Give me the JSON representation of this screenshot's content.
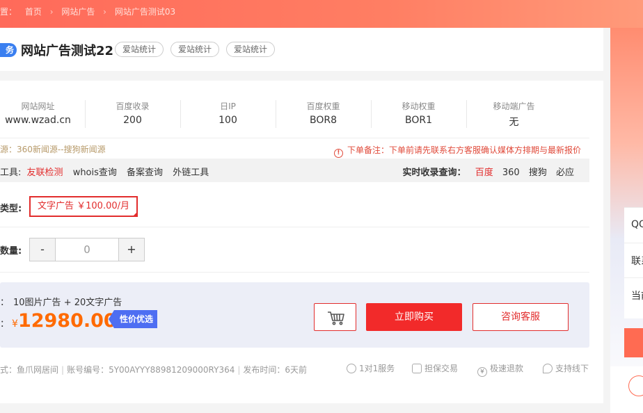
{
  "breadcrumb": {
    "prefix": "置：",
    "items": [
      "首页",
      "网站广告",
      "网站广告测试03"
    ],
    "separator": "›"
  },
  "listing": {
    "service_badge": "务",
    "title": "网站广告测试22",
    "tags": [
      "爱站统计",
      "爱站统计",
      "爱站统计"
    ]
  },
  "stats": [
    {
      "label": "网站网址",
      "value": "www.wzad.cn"
    },
    {
      "label": "百度收录",
      "value": "200"
    },
    {
      "label": "日IP",
      "value": "100"
    },
    {
      "label": "百度权重",
      "value": "BOR8"
    },
    {
      "label": "移动权重",
      "value": "BOR1"
    },
    {
      "label": "移动端广告",
      "value": "无"
    }
  ],
  "source_text": "源：360新闻源--搜狗新闻源",
  "order_note": "下单备注：下单前请先联系右方客服确认媒体方排期与最新报价",
  "tools": {
    "label": "工具:",
    "items": [
      "友联检测",
      "whois查询",
      "备案查询",
      "外链工具"
    ],
    "realtime_label": "实时收录查询：",
    "engines": [
      "百度",
      "360",
      "搜狗",
      "必应"
    ]
  },
  "ad_type": {
    "label": "类型:",
    "option": "文字广告 ￥100.00/月"
  },
  "quantity": {
    "label": "数量:",
    "minus": "-",
    "value": "0",
    "plus": "+"
  },
  "package": {
    "label": "：",
    "text": "10图片广告 + 20文字广告",
    "price_label": "：",
    "currency": "¥",
    "price": "12980.00",
    "deal_tag": "性价优选"
  },
  "actions": {
    "buy": "立即购买",
    "consult": "咨询客服"
  },
  "meta": {
    "method": "式：鱼爪网居间",
    "account": "账号编号：5Y00AYYY88981209000RY364",
    "published": "发布时间：6天前"
  },
  "guarantees": [
    "1对1服务",
    "担保交易",
    "极速退款",
    "支持线下"
  ],
  "right_sidebar": {
    "items": [
      "QQ",
      "联系",
      "当前"
    ]
  }
}
